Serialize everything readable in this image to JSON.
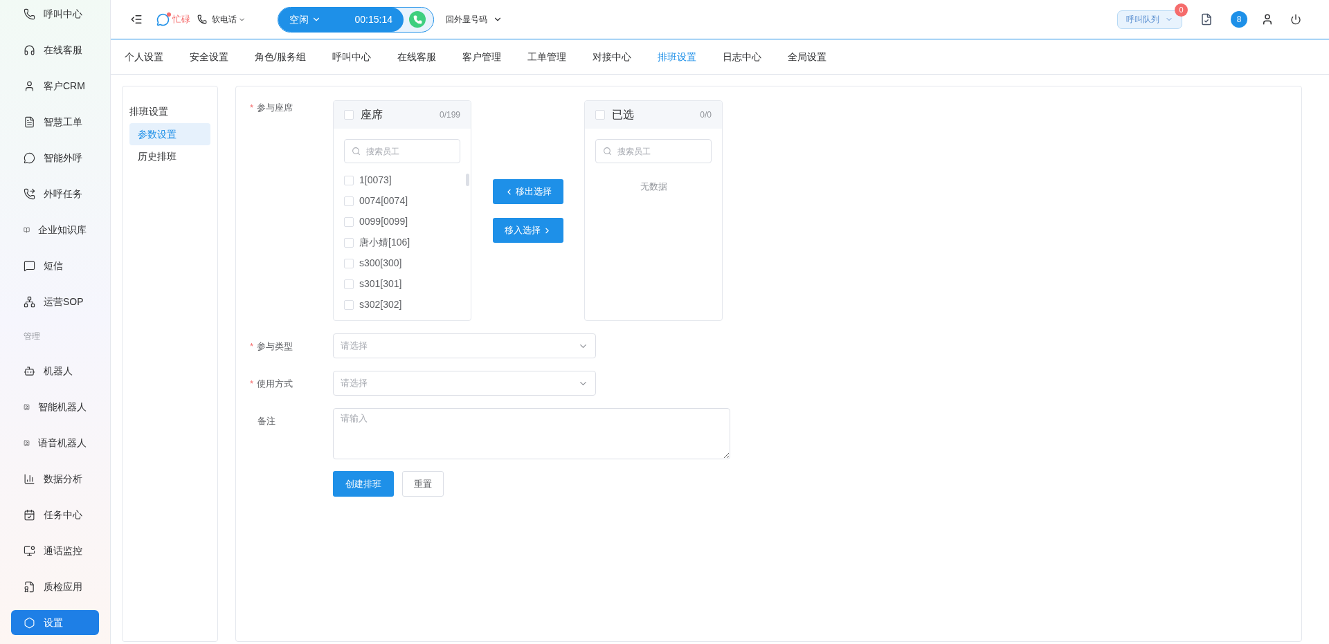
{
  "sidebar": {
    "items": [
      {
        "label": "呼叫中心",
        "selected": false
      },
      {
        "label": "在线客服",
        "selected": false
      },
      {
        "label": "客户CRM",
        "selected": false
      },
      {
        "label": "智慧工单",
        "selected": false
      },
      {
        "label": "智能外呼",
        "selected": false
      },
      {
        "label": "外呼任务",
        "selected": false
      },
      {
        "label": "企业知识库",
        "selected": false
      },
      {
        "label": "短信",
        "selected": false
      },
      {
        "label": "运营SOP",
        "selected": false
      }
    ],
    "section_label": "管理",
    "admin_items": [
      {
        "label": "机器人",
        "selected": false
      },
      {
        "label": "智能机器人",
        "selected": false
      },
      {
        "label": "语音机器人",
        "selected": false
      },
      {
        "label": "数据分析",
        "selected": false
      },
      {
        "label": "任务中心",
        "selected": false
      },
      {
        "label": "通话监控",
        "selected": false
      },
      {
        "label": "质检应用",
        "selected": false
      },
      {
        "label": "设置",
        "selected": true
      }
    ]
  },
  "top_bar": {
    "busy_status": "忙碌",
    "softphone": "软电话",
    "agent_state": "空闲",
    "call_timer": "00:15:14",
    "caller_id": "回外显号码",
    "queue_button": "呼叫队列",
    "queue_badge": "0",
    "avatar_badge": "8"
  },
  "tabs": [
    {
      "label": "个人设置",
      "selected": false
    },
    {
      "label": "安全设置",
      "selected": false
    },
    {
      "label": "角色/服务组",
      "selected": false
    },
    {
      "label": "呼叫中心",
      "selected": false
    },
    {
      "label": "在线客服",
      "selected": false
    },
    {
      "label": "客户管理",
      "selected": false
    },
    {
      "label": "工单管理",
      "selected": false
    },
    {
      "label": "对接中心",
      "selected": false
    },
    {
      "label": "排班设置",
      "selected": true
    },
    {
      "label": "日志中心",
      "selected": false
    },
    {
      "label": "全局设置",
      "selected": false
    }
  ],
  "submenu": {
    "title": "排班设置",
    "items": [
      {
        "label": "参数设置",
        "selected": true
      },
      {
        "label": "历史排班",
        "selected": false
      }
    ]
  },
  "form": {
    "seats": {
      "label": "参与座席",
      "required_mark": "*",
      "source": {
        "title": "座席",
        "count": "0/199",
        "checked": false,
        "search_placeholder": "搜索员工",
        "items": [
          {
            "label": "1[0073]",
            "checked": false
          },
          {
            "label": "0074[0074]",
            "checked": false
          },
          {
            "label": "0099[0099]",
            "checked": false
          },
          {
            "label": "唐小婧[106]",
            "checked": false
          },
          {
            "label": "s300[300]",
            "checked": false
          },
          {
            "label": "s301[301]",
            "checked": false
          },
          {
            "label": "s302[302]",
            "checked": false
          }
        ]
      },
      "move_out": "移出选择",
      "move_in": "移入选择",
      "target": {
        "title": "已选",
        "count": "0/0",
        "checked": false,
        "search_placeholder": "搜索员工",
        "empty_text": "无数据"
      }
    },
    "fields": [
      {
        "kind": "select",
        "label": "参与类型",
        "required_mark": "*",
        "placeholder": "请选择"
      },
      {
        "kind": "select",
        "label": "使用方式",
        "required_mark": "*",
        "placeholder": "请选择"
      },
      {
        "kind": "textarea",
        "label": "备注",
        "placeholder": "请输入"
      }
    ],
    "submit": "创建排班",
    "reset": "重置"
  }
}
